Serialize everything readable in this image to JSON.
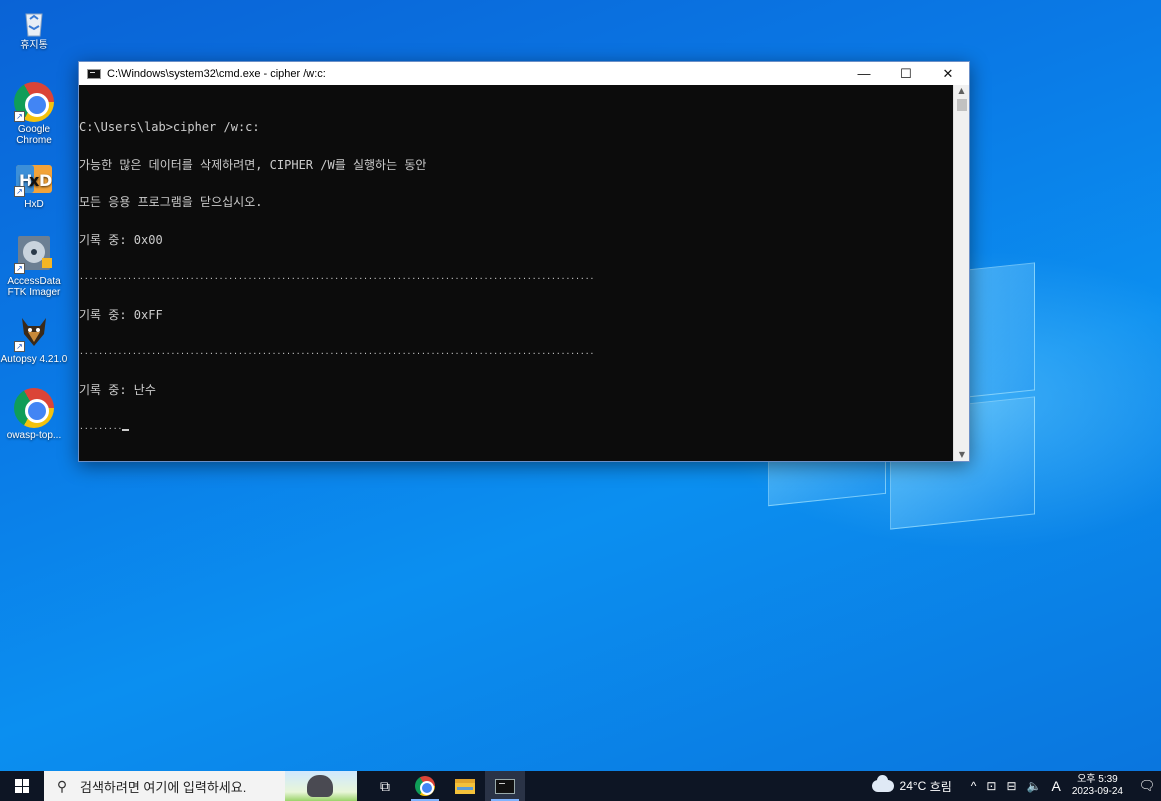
{
  "desktop": {
    "icons": [
      {
        "label": "휴지통",
        "icon": "recycle-bin-icon"
      },
      {
        "label": "Google Chrome",
        "icon": "chrome-icon"
      },
      {
        "label": "HxD",
        "icon": "hxd-icon"
      },
      {
        "label": "AccessData FTK Imager",
        "icon": "ftk-imager-icon"
      },
      {
        "label": "Autopsy 4.21.0",
        "icon": "autopsy-icon"
      },
      {
        "label": "owasp-top...",
        "icon": "chrome-icon"
      }
    ]
  },
  "cmd_window": {
    "title": "C:\\Windows\\system32\\cmd.exe - cipher  /w:c:",
    "controls": {
      "minimize": "—",
      "maximize": "☐",
      "close": "✕"
    },
    "lines": [
      "C:\\Users\\lab>cipher /w:c:",
      "가능한 많은 데이터를 삭제하려면, CIPHER /W를 실행하는 동안",
      "모든 응용 프로그램을 닫으십시오.",
      "기록 중: 0x00",
      "...........................................................................................................",
      "기록 중: 0xFF",
      "...........................................................................................................",
      "기록 중: 난수",
      "........."
    ]
  },
  "taskbar": {
    "search_placeholder": "검색하려면 여기에 입력하세요.",
    "apps": [
      "task-view",
      "chrome",
      "file-explorer",
      "cmd"
    ],
    "weather": {
      "temp": "24°C",
      "condition": "흐림"
    },
    "tray_icons": [
      "^",
      "⊡",
      "⊟",
      "🔈",
      "A"
    ],
    "clock": {
      "time": "오후 5:39",
      "date": "2023-09-24"
    }
  },
  "colors": {
    "console_bg": "#0c0c0c",
    "console_fg": "#cccccc",
    "taskbar_bg": "#0d1524",
    "desktop_blue": "#0a7ae6"
  }
}
